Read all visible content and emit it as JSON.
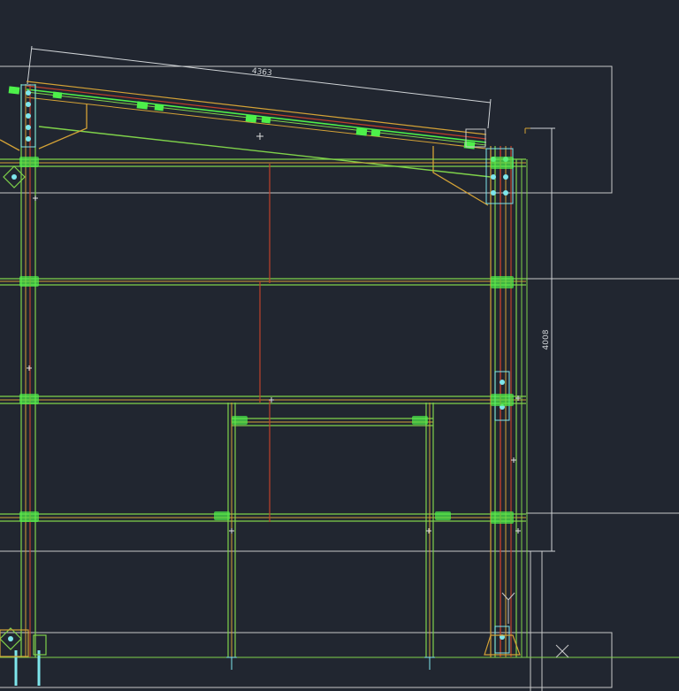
{
  "colors": {
    "background": "#212630",
    "grid": "#c8c8c8",
    "dimension": "#cfd3d6",
    "member_green": "#7fd24a",
    "member_bright": "#4df04a",
    "member_orange": "#d4a236",
    "member_red": "#c0402b",
    "connection_cyan": "#7ee6ec",
    "crosshair": "#e0e0e0"
  },
  "dimensions": {
    "rafter_length": "4363",
    "column_height": "4008"
  },
  "icons": {
    "ucs": "ucs-icon",
    "cursor": "crosshair-cursor-icon",
    "close_marker": "x-marker-icon"
  }
}
